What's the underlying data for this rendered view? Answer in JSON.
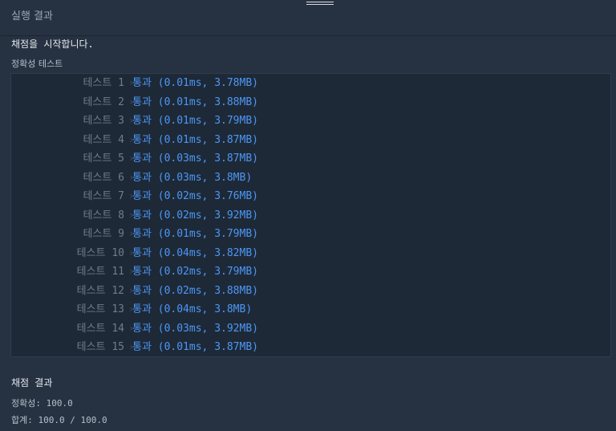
{
  "header": {
    "title": "실행 결과"
  },
  "start_message": "채점을 시작합니다.",
  "section_label": "정확성  테스트",
  "tests": [
    {
      "name": "테스트 1",
      "status": "통과",
      "detail": "(0.01ms, 3.78MB)"
    },
    {
      "name": "테스트 2",
      "status": "통과",
      "detail": "(0.01ms, 3.88MB)"
    },
    {
      "name": "테스트 3",
      "status": "통과",
      "detail": "(0.01ms, 3.79MB)"
    },
    {
      "name": "테스트 4",
      "status": "통과",
      "detail": "(0.01ms, 3.87MB)"
    },
    {
      "name": "테스트 5",
      "status": "통과",
      "detail": "(0.03ms, 3.87MB)"
    },
    {
      "name": "테스트 6",
      "status": "통과",
      "detail": "(0.03ms, 3.8MB)"
    },
    {
      "name": "테스트 7",
      "status": "통과",
      "detail": "(0.02ms, 3.76MB)"
    },
    {
      "name": "테스트 8",
      "status": "통과",
      "detail": "(0.02ms, 3.92MB)"
    },
    {
      "name": "테스트 9",
      "status": "통과",
      "detail": "(0.01ms, 3.79MB)"
    },
    {
      "name": "테스트 10",
      "status": "통과",
      "detail": "(0.04ms, 3.82MB)"
    },
    {
      "name": "테스트 11",
      "status": "통과",
      "detail": "(0.02ms, 3.79MB)"
    },
    {
      "name": "테스트 12",
      "status": "통과",
      "detail": "(0.02ms, 3.88MB)"
    },
    {
      "name": "테스트 13",
      "status": "통과",
      "detail": "(0.04ms, 3.8MB)"
    },
    {
      "name": "테스트 14",
      "status": "통과",
      "detail": "(0.03ms, 3.92MB)"
    },
    {
      "name": "테스트 15",
      "status": "통과",
      "detail": "(0.01ms, 3.87MB)"
    }
  ],
  "grading": {
    "title": "채점 결과",
    "accuracy": "정확성: 100.0",
    "total": "합계: 100.0 / 100.0"
  },
  "icons": {
    "row_arrow": "chevron-right-icon",
    "drag": "drag-handle-icon"
  },
  "colors": {
    "pass": "#4c97f5",
    "background": "#263242",
    "panel": "#1e2937"
  }
}
